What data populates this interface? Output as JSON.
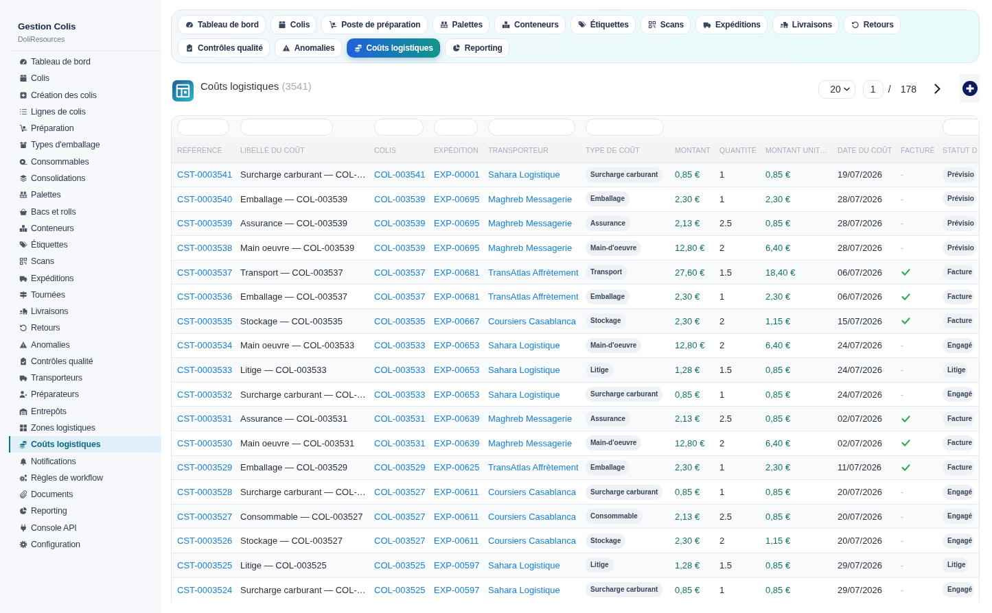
{
  "sidebar": {
    "title": "Gestion Colis",
    "subtitle": "DoliResources",
    "items": [
      {
        "label": "Tableau de bord",
        "selected": false
      },
      {
        "label": "Colis",
        "selected": false
      },
      {
        "label": "Création des colis",
        "selected": false
      },
      {
        "label": "Lignes de colis",
        "selected": false
      },
      {
        "label": "Préparation",
        "selected": false
      },
      {
        "label": "Types d'emballage",
        "selected": false
      },
      {
        "label": "Consommables",
        "selected": false
      },
      {
        "label": "Consolidations",
        "selected": false
      },
      {
        "label": "Palettes",
        "selected": false
      },
      {
        "label": "Bacs et rolls",
        "selected": false
      },
      {
        "label": "Conteneurs",
        "selected": false
      },
      {
        "label": "Étiquettes",
        "selected": false
      },
      {
        "label": "Scans",
        "selected": false
      },
      {
        "label": "Expéditions",
        "selected": false
      },
      {
        "label": "Tournées",
        "selected": false
      },
      {
        "label": "Livraisons",
        "selected": false
      },
      {
        "label": "Retours",
        "selected": false
      },
      {
        "label": "Anomalies",
        "selected": false
      },
      {
        "label": "Contrôles qualité",
        "selected": false
      },
      {
        "label": "Transporteurs",
        "selected": false
      },
      {
        "label": "Préparateurs",
        "selected": false
      },
      {
        "label": "Entrepôts",
        "selected": false
      },
      {
        "label": "Zones logistiques",
        "selected": false
      },
      {
        "label": "Coûts logistiques",
        "selected": true
      },
      {
        "label": "Notifications",
        "selected": false
      },
      {
        "label": "Règles de workflow",
        "selected": false
      },
      {
        "label": "Documents",
        "selected": false
      },
      {
        "label": "Reporting",
        "selected": false
      },
      {
        "label": "Console API",
        "selected": false
      },
      {
        "label": "Configuration",
        "selected": false
      }
    ]
  },
  "tab_rows": [
    [
      {
        "label": "Tableau de bord",
        "selected": false
      },
      {
        "label": "Colis",
        "selected": false
      },
      {
        "label": "Poste de préparation",
        "selected": false
      },
      {
        "label": "Palettes",
        "selected": false
      },
      {
        "label": "Conteneurs",
        "selected": false
      },
      {
        "label": "Étiquettes",
        "selected": false
      },
      {
        "label": "Scans",
        "selected": false
      },
      {
        "label": "Expéditions",
        "selected": false
      },
      {
        "label": "Livraisons",
        "selected": false
      },
      {
        "label": "Retours",
        "selected": false
      }
    ],
    [
      {
        "label": "Contrôles qualité",
        "selected": false
      },
      {
        "label": "Anomalies",
        "selected": false
      },
      {
        "label": "Coûts logistiques",
        "selected": true
      },
      {
        "label": "Reporting",
        "selected": false
      }
    ]
  ],
  "header": {
    "title": "Coûts logistiques",
    "count": "(3541)"
  },
  "pagination": {
    "page_size": "20",
    "page": "1",
    "separator": "/",
    "total_pages": "178"
  },
  "table": {
    "columns": [
      {
        "label": "RÉFÉRENCE",
        "filter": true
      },
      {
        "label": "LIBELLÉ DU COÛT",
        "filter": true
      },
      {
        "label": "COLIS",
        "filter": true
      },
      {
        "label": "EXPÉDITION",
        "filter": true
      },
      {
        "label": "TRANSPORTEUR",
        "filter": true
      },
      {
        "label": "TYPE DE COÛT",
        "filter": true
      },
      {
        "label": "MONTANT",
        "filter": false
      },
      {
        "label": "QUANTITÉ",
        "filter": false
      },
      {
        "label": "MONTANT UNIT…",
        "filter": false
      },
      {
        "label": "DATE DU COÛT",
        "filter": false
      },
      {
        "label": "FACTURÉ",
        "filter": false
      },
      {
        "label": "STATUT D",
        "filter": true
      }
    ],
    "rows": [
      {
        "reference": "CST-0003541",
        "label": "Surcharge carburant — COL-…",
        "parcel": "COL-003541",
        "shipment": "EXP-00001",
        "carrier": "Sahara Logistique",
        "cost_type": "Surcharge carburant",
        "amount": "0,85 €",
        "quantity": "1",
        "unit_amount": "0,85 €",
        "date": "19/07/2026",
        "invoiced": false,
        "invoiced_text": "-",
        "status": "Prévisio"
      },
      {
        "reference": "CST-0003540",
        "label": "Emballage — COL-003539",
        "parcel": "COL-003539",
        "shipment": "EXP-00695",
        "carrier": "Maghreb Messagerie",
        "cost_type": "Emballage",
        "amount": "2,30 €",
        "quantity": "1",
        "unit_amount": "2,30 €",
        "date": "28/07/2026",
        "invoiced": false,
        "invoiced_text": "-",
        "status": "Prévisio"
      },
      {
        "reference": "CST-0003539",
        "label": "Assurance — COL-003539",
        "parcel": "COL-003539",
        "shipment": "EXP-00695",
        "carrier": "Maghreb Messagerie",
        "cost_type": "Assurance",
        "amount": "2,13 €",
        "quantity": "2.5",
        "unit_amount": "0,85 €",
        "date": "28/07/2026",
        "invoiced": false,
        "invoiced_text": "-",
        "status": "Prévisio"
      },
      {
        "reference": "CST-0003538",
        "label": "Main oeuvre — COL-003539",
        "parcel": "COL-003539",
        "shipment": "EXP-00695",
        "carrier": "Maghreb Messagerie",
        "cost_type": "Main-d'oeuvre",
        "amount": "12,80 €",
        "quantity": "2",
        "unit_amount": "6,40 €",
        "date": "28/07/2026",
        "invoiced": false,
        "invoiced_text": "-",
        "status": "Prévisio"
      },
      {
        "reference": "CST-0003537",
        "label": "Transport — COL-003537",
        "parcel": "COL-003537",
        "shipment": "EXP-00681",
        "carrier": "TransAtlas Affrètement",
        "cost_type": "Transport",
        "amount": "27,60 €",
        "quantity": "1.5",
        "unit_amount": "18,40 €",
        "date": "06/07/2026",
        "invoiced": true,
        "status": "Facture"
      },
      {
        "reference": "CST-0003536",
        "label": "Emballage — COL-003537",
        "parcel": "COL-003537",
        "shipment": "EXP-00681",
        "carrier": "TransAtlas Affrètement",
        "cost_type": "Emballage",
        "amount": "2,30 €",
        "quantity": "1",
        "unit_amount": "2,30 €",
        "date": "06/07/2026",
        "invoiced": true,
        "status": "Facture"
      },
      {
        "reference": "CST-0003535",
        "label": "Stockage — COL-003535",
        "parcel": "COL-003535",
        "shipment": "EXP-00667",
        "carrier": "Coursiers Casablanca",
        "cost_type": "Stockage",
        "amount": "2,30 €",
        "quantity": "2",
        "unit_amount": "1,15 €",
        "date": "15/07/2026",
        "invoiced": true,
        "status": "Facture"
      },
      {
        "reference": "CST-0003534",
        "label": "Main oeuvre — COL-003533",
        "parcel": "COL-003533",
        "shipment": "EXP-00653",
        "carrier": "Sahara Logistique",
        "cost_type": "Main-d'oeuvre",
        "amount": "12,80 €",
        "quantity": "2",
        "unit_amount": "6,40 €",
        "date": "24/07/2026",
        "invoiced": false,
        "invoiced_text": "-",
        "status": "Engagé"
      },
      {
        "reference": "CST-0003533",
        "label": "Litige — COL-003533",
        "parcel": "COL-003533",
        "shipment": "EXP-00653",
        "carrier": "Sahara Logistique",
        "cost_type": "Litige",
        "amount": "1,28 €",
        "quantity": "1.5",
        "unit_amount": "0,85 €",
        "date": "24/07/2026",
        "invoiced": false,
        "invoiced_text": "-",
        "status": "Litige"
      },
      {
        "reference": "CST-0003532",
        "label": "Surcharge carburant — COL-…",
        "parcel": "COL-003533",
        "shipment": "EXP-00653",
        "carrier": "Sahara Logistique",
        "cost_type": "Surcharge carburant",
        "amount": "0,85 €",
        "quantity": "1",
        "unit_amount": "0,85 €",
        "date": "24/07/2026",
        "invoiced": false,
        "invoiced_text": "-",
        "status": "Engagé"
      },
      {
        "reference": "CST-0003531",
        "label": "Assurance — COL-003531",
        "parcel": "COL-003531",
        "shipment": "EXP-00639",
        "carrier": "Maghreb Messagerie",
        "cost_type": "Assurance",
        "amount": "2,13 €",
        "quantity": "2.5",
        "unit_amount": "0,85 €",
        "date": "02/07/2026",
        "invoiced": true,
        "status": "Facture"
      },
      {
        "reference": "CST-0003530",
        "label": "Main oeuvre — COL-003531",
        "parcel": "COL-003531",
        "shipment": "EXP-00639",
        "carrier": "Maghreb Messagerie",
        "cost_type": "Main-d'oeuvre",
        "amount": "12,80 €",
        "quantity": "2",
        "unit_amount": "6,40 €",
        "date": "02/07/2026",
        "invoiced": true,
        "status": "Facture"
      },
      {
        "reference": "CST-0003529",
        "label": "Emballage — COL-003529",
        "parcel": "COL-003529",
        "shipment": "EXP-00625",
        "carrier": "TransAtlas Affrètement",
        "cost_type": "Emballage",
        "amount": "2,30 €",
        "quantity": "1",
        "unit_amount": "2,30 €",
        "date": "11/07/2026",
        "invoiced": true,
        "status": "Facture"
      },
      {
        "reference": "CST-0003528",
        "label": "Surcharge carburant — COL-…",
        "parcel": "COL-003527",
        "shipment": "EXP-00611",
        "carrier": "Coursiers Casablanca",
        "cost_type": "Surcharge carburant",
        "amount": "0,85 €",
        "quantity": "1",
        "unit_amount": "0,85 €",
        "date": "20/07/2026",
        "invoiced": false,
        "invoiced_text": "-",
        "status": "Engagé"
      },
      {
        "reference": "CST-0003527",
        "label": "Consommable — COL-003527",
        "parcel": "COL-003527",
        "shipment": "EXP-00611",
        "carrier": "Coursiers Casablanca",
        "cost_type": "Consommable",
        "amount": "2,13 €",
        "quantity": "2.5",
        "unit_amount": "0,85 €",
        "date": "20/07/2026",
        "invoiced": false,
        "invoiced_text": "-",
        "status": "Engagé"
      },
      {
        "reference": "CST-0003526",
        "label": "Stockage — COL-003527",
        "parcel": "COL-003527",
        "shipment": "EXP-00611",
        "carrier": "Coursiers Casablanca",
        "cost_type": "Stockage",
        "amount": "2,30 €",
        "quantity": "2",
        "unit_amount": "1,15 €",
        "date": "20/07/2026",
        "invoiced": false,
        "invoiced_text": "-",
        "status": "Engagé"
      },
      {
        "reference": "CST-0003525",
        "label": "Litige — COL-003525",
        "parcel": "COL-003525",
        "shipment": "EXP-00597",
        "carrier": "Sahara Logistique",
        "cost_type": "Litige",
        "amount": "1,28 €",
        "quantity": "1.5",
        "unit_amount": "0,85 €",
        "date": "29/07/2026",
        "invoiced": false,
        "invoiced_text": "-",
        "status": "Litige"
      },
      {
        "reference": "CST-0003524",
        "label": "Surcharge carburant — COL-…",
        "parcel": "COL-003525",
        "shipment": "EXP-00597",
        "carrier": "Sahara Logistique",
        "cost_type": "Surcharge carburant",
        "amount": "0,85 €",
        "quantity": "1",
        "unit_amount": "0,85 €",
        "date": "29/07/2026",
        "invoiced": false,
        "invoiced_text": "-",
        "status": "Engagé"
      }
    ]
  }
}
